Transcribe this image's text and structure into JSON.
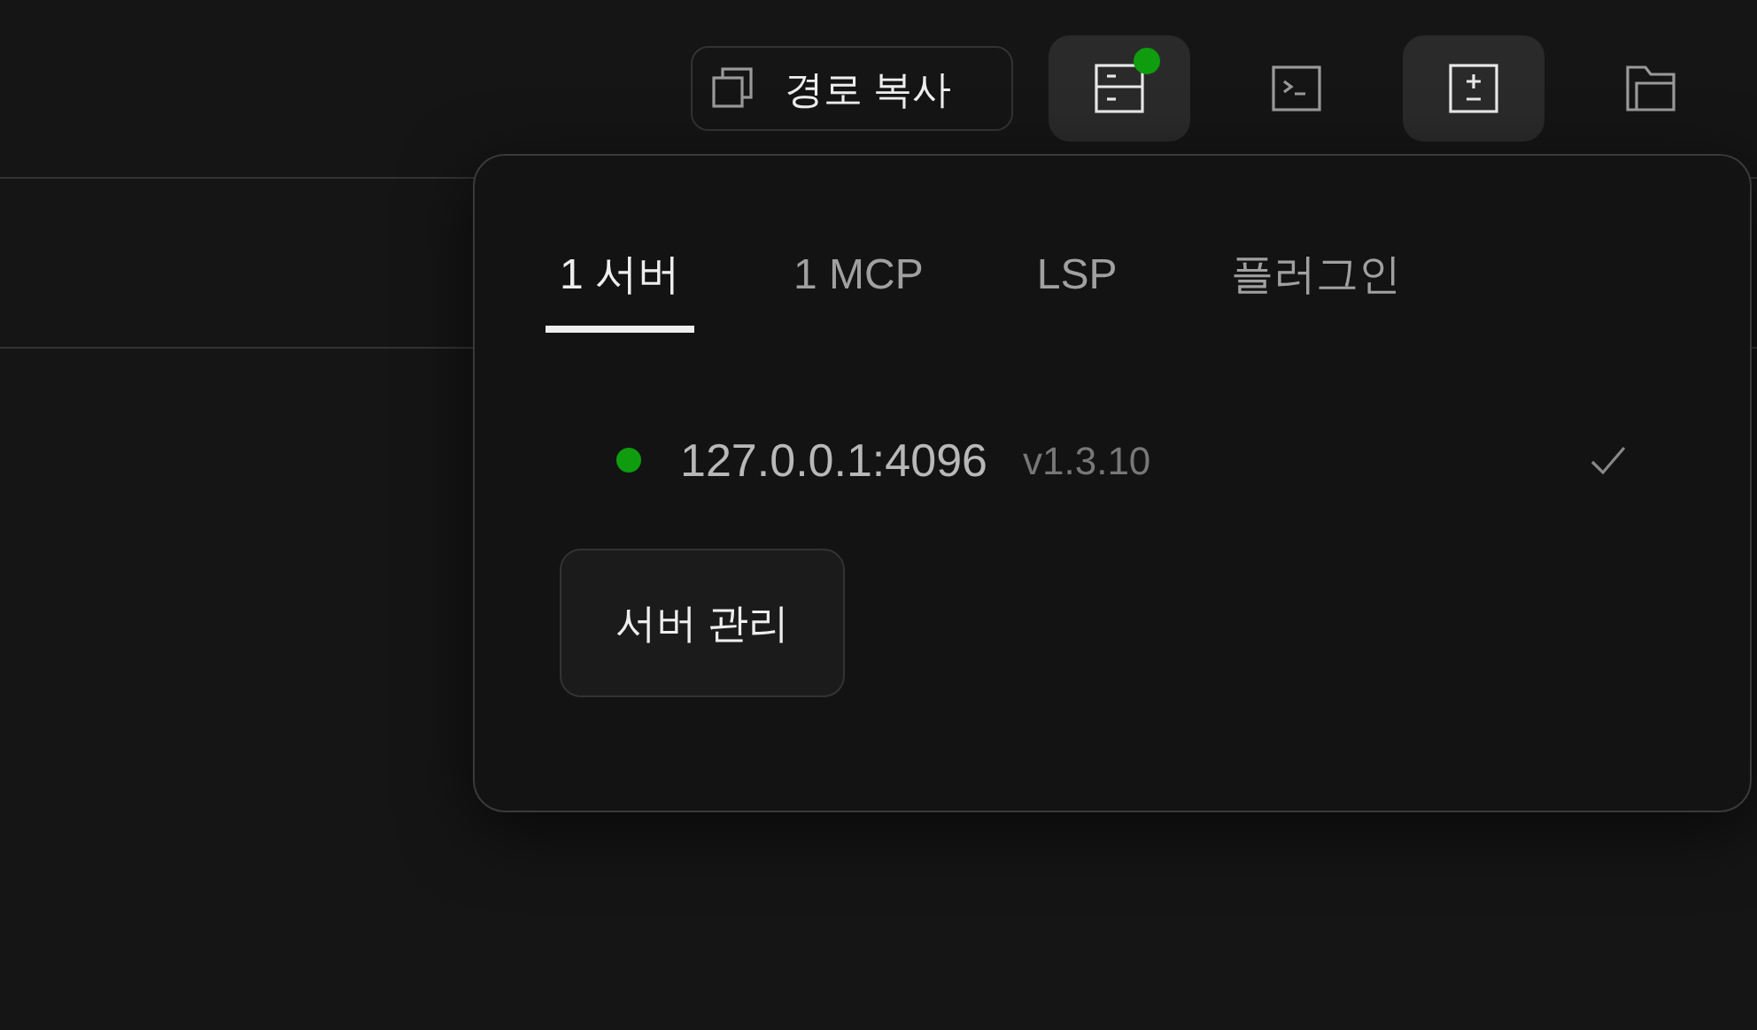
{
  "toolbar": [
    {
      "kind": "copy",
      "label": "경로 복사",
      "highlighted": false
    },
    {
      "kind": "servers",
      "highlighted": true,
      "color": "#0f9d0f"
    },
    {
      "kind": "terminal",
      "highlighted": false
    },
    {
      "kind": "diff",
      "highlighted": true
    },
    {
      "kind": "folder",
      "highlighted": false
    }
  ],
  "popover": {
    "tabs": [
      {
        "label": "1 서버",
        "selected": true
      },
      {
        "label": "1 MCP",
        "selected": false
      },
      {
        "label": "LSP",
        "selected": false
      },
      {
        "label": "플러그인",
        "selected": false
      }
    ],
    "servers": [
      {
        "address": "127.0.0.1:4096",
        "version": "v1.3.10",
        "color": "#0f9d0f",
        "checked": true
      }
    ],
    "manage_button": "서버 관리"
  }
}
